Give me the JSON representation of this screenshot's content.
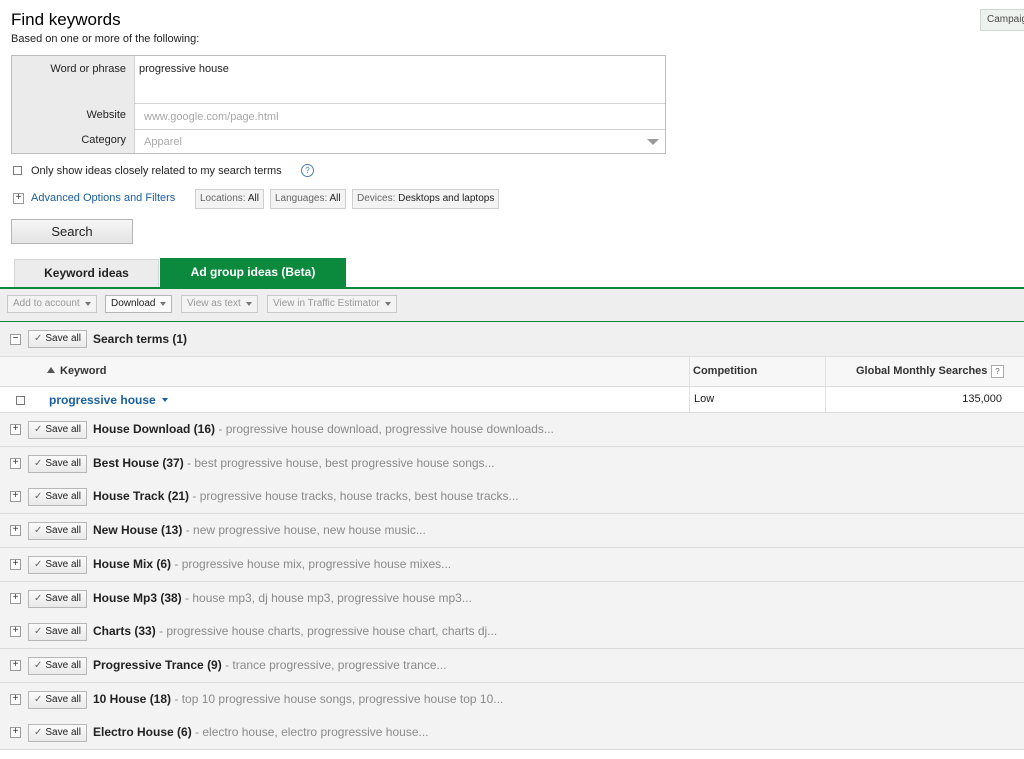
{
  "header": {
    "title": "Find keywords",
    "subtitle": "Based on one or more of the following:",
    "campaign_button": "Campaign"
  },
  "form": {
    "word_label": "Word or phrase",
    "word_value": "progressive house",
    "website_label": "Website",
    "website_placeholder": "www.google.com/page.html",
    "category_label": "Category",
    "category_placeholder": "Apparel"
  },
  "options": {
    "only_related": "Only show ideas closely related to my search terms",
    "help": "?",
    "advanced": "Advanced Options and Filters",
    "chips": [
      {
        "label": "Locations:",
        "value": "All"
      },
      {
        "label": "Languages:",
        "value": "All"
      },
      {
        "label": "Devices:",
        "value": "Desktops and laptops"
      }
    ],
    "search_button": "Search"
  },
  "tabs": [
    {
      "label": "Keyword ideas",
      "active": false
    },
    {
      "label": "Ad group ideas (Beta)",
      "active": true
    }
  ],
  "toolbar": {
    "add_to_account": "Add to account",
    "download": "Download",
    "view_as_text": "View as text",
    "view_in_traffic": "View in Traffic Estimator"
  },
  "search_terms": {
    "title": "Search terms (1)",
    "save_all": "Save all",
    "columns": {
      "keyword": "Keyword",
      "competition": "Competition",
      "global": "Global Monthly Searches",
      "help": "?"
    },
    "row": {
      "keyword": "progressive house",
      "competition": "Low",
      "global": "135,000"
    }
  },
  "groups": [
    {
      "name": "House Download (16)",
      "summary": "- progressive house download, progressive house downloads..."
    },
    {
      "name": "Best House (37)",
      "summary": "- best progressive house, best progressive house songs..."
    },
    {
      "name": "House Track (21)",
      "summary": "- progressive house tracks, house tracks, best house tracks..."
    },
    {
      "name": "New House (13)",
      "summary": "- new progressive house, new house music..."
    },
    {
      "name": "House Mix (6)",
      "summary": "- progressive house mix, progressive house mixes..."
    },
    {
      "name": "House Mp3 (38)",
      "summary": "- house mp3, dj house mp3, progressive house mp3..."
    },
    {
      "name": "Charts (33)",
      "summary": "- progressive house charts, progressive house chart, charts dj..."
    },
    {
      "name": "Progressive Trance (9)",
      "summary": "- trance progressive, progressive trance..."
    },
    {
      "name": "10 House (18)",
      "summary": "- top 10 progressive house songs, progressive house top 10..."
    },
    {
      "name": "Electro House (6)",
      "summary": "- electro house, electro progressive house..."
    }
  ],
  "colors": {
    "accent": "#0b8a3d",
    "link": "#1a5fa0"
  }
}
